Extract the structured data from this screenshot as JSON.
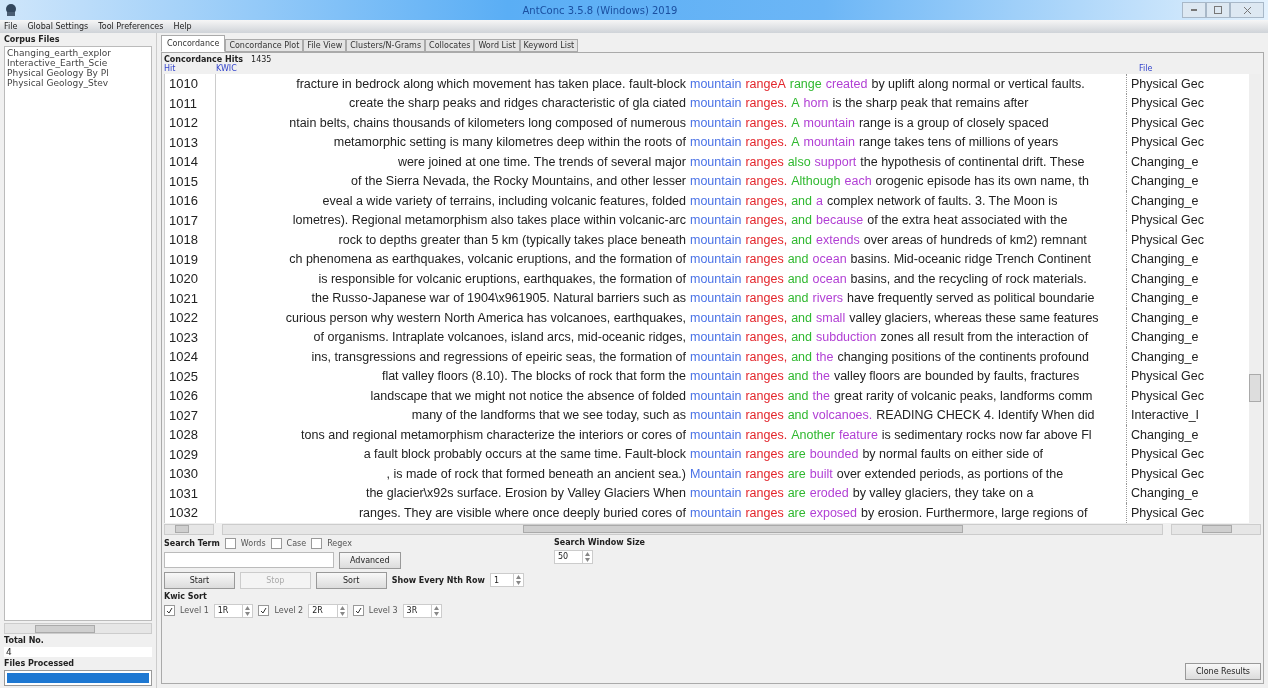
{
  "window": {
    "title": "AntConc 3.5.8 (Windows) 2019"
  },
  "menu": [
    "File",
    "Global Settings",
    "Tool Preferences",
    "Help"
  ],
  "sidebar": {
    "title": "Corpus Files",
    "files": [
      "Changing_earth_explor",
      "Interactive_Earth_Scie",
      "Physical Geology By Pl",
      "Physical Geology_Stev"
    ],
    "total_label": "Total No.",
    "total": "4",
    "processed_label": "Files Processed",
    "progress": {
      "level": 1
    }
  },
  "tabs": [
    {
      "label": "Concordance",
      "selected": true
    },
    {
      "label": "Concordance Plot",
      "selected": false
    },
    {
      "label": "File View",
      "selected": false
    },
    {
      "label": "Clusters/N-Grams",
      "selected": false
    },
    {
      "label": "Collocates",
      "selected": false
    },
    {
      "label": "Word List",
      "selected": false
    },
    {
      "label": "Keyword List",
      "selected": false
    }
  ],
  "hits_label": "Concordance Hits",
  "hits": "1435",
  "columns": [
    "Hit",
    "KWIC",
    "File"
  ],
  "rows": [
    {
      "hit": "1010",
      "left": "fracture in bedrock along which movement has taken place. fault-block",
      "keyword": "mountain",
      "r1": "rangeA",
      "r2": "range",
      "r3": "created",
      "rest": "by uplift along normal or vertical faults.",
      "file": "Physical Gec"
    },
    {
      "hit": "1011",
      "left": "create the sharp peaks and ridges characteristic of gla ciated",
      "keyword": "mountain",
      "r1": "ranges.",
      "r2": "A",
      "r3": "horn",
      "rest": "is the sharp peak that remains after",
      "file": "Physical Gec"
    },
    {
      "hit": "1012",
      "left": "ntain belts, chains thousands of kilometers long composed of numerous",
      "keyword": "mountain",
      "r1": "ranges.",
      "r2": "A",
      "r3": "mountain",
      "rest": "range is a group of closely spaced",
      "file": "Physical Gec"
    },
    {
      "hit": "1013",
      "left": "metamorphic setting is many kilometres deep within the roots of",
      "keyword": "mountain",
      "r1": "ranges.",
      "r2": "A",
      "r3": "mountain",
      "rest": "range takes tens of millions of years",
      "file": "Physical Gec"
    },
    {
      "hit": "1014",
      "left": "were joined at one time. The trends of several major",
      "keyword": "mountain",
      "r1": "ranges",
      "r2": "also",
      "r3": "support",
      "rest": "the hypothesis of continental drift. These",
      "file": "Changing_e"
    },
    {
      "hit": "1015",
      "left": "of the Sierra Nevada, the Rocky Mountains, and other lesser",
      "keyword": "mountain",
      "r1": "ranges.",
      "r2": "Although",
      "r3": "each",
      "rest": "orogenic episode has its own name, th",
      "file": "Changing_e"
    },
    {
      "hit": "1016",
      "left": "eveal a wide variety of terrains, including volcanic features, folded",
      "keyword": "mountain",
      "r1": "ranges,",
      "r2": "and",
      "r3": "a",
      "rest": "complex network of faults. 3. The Moon is",
      "file": "Changing_e"
    },
    {
      "hit": "1017",
      "left": "lometres). Regional metamorphism also takes place within volcanic-arc",
      "keyword": "mountain",
      "r1": "ranges,",
      "r2": "and",
      "r3": "because",
      "rest": "of the extra heat associated with the",
      "file": "Physical Gec"
    },
    {
      "hit": "1018",
      "left": "rock to depths greater than 5 km (typically takes place beneath",
      "keyword": "mountain",
      "r1": "ranges,",
      "r2": "and",
      "r3": "extends",
      "rest": "over areas of hundreds of km2) remnant",
      "file": "Physical Gec"
    },
    {
      "hit": "1019",
      "left": "ch phenomena as earthquakes, volcanic eruptions, and the formation of",
      "keyword": "mountain",
      "r1": "ranges",
      "r2": "and",
      "r3": "ocean",
      "rest": "basins. Mid-oceanic ridge Trench Continent",
      "file": "Changing_e"
    },
    {
      "hit": "1020",
      "left": "is responsible for volcanic eruptions, earthquakes, the formation of",
      "keyword": "mountain",
      "r1": "ranges",
      "r2": "and",
      "r3": "ocean",
      "rest": "basins, and the recycling of rock materials.",
      "file": "Changing_e"
    },
    {
      "hit": "1021",
      "left": "the Russo-Japanese war of 1904\\x961905. Natural barriers such as",
      "keyword": "mountain",
      "r1": "ranges",
      "r2": "and",
      "r3": "rivers",
      "rest": "have frequently served as political boundarie",
      "file": "Changing_e"
    },
    {
      "hit": "1022",
      "left": "curious person why western North America has volcanoes, earthquakes,",
      "keyword": "mountain",
      "r1": "ranges,",
      "r2": "and",
      "r3": "small",
      "rest": "valley glaciers, whereas these same features",
      "file": "Changing_e"
    },
    {
      "hit": "1023",
      "left": "of organisms. Intraplate volcanoes, island arcs, mid-oceanic ridges,",
      "keyword": "mountain",
      "r1": "ranges,",
      "r2": "and",
      "r3": "subduction",
      "rest": "zones all result from the interaction of",
      "file": "Changing_e"
    },
    {
      "hit": "1024",
      "left": "ins, transgressions and regressions of epeiric seas, the formation of",
      "keyword": "mountain",
      "r1": "ranges,",
      "r2": "and",
      "r3": "the",
      "rest": "changing positions of the continents profound",
      "file": "Changing_e"
    },
    {
      "hit": "1025",
      "left": "flat valley floors (8.10). The blocks of rock that form the",
      "keyword": "mountain",
      "r1": "ranges",
      "r2": "and",
      "r3": "the",
      "rest": "valley floors are bounded by faults, fractures",
      "file": "Physical Gec"
    },
    {
      "hit": "1026",
      "left": "landscape that we might not notice the absence of folded",
      "keyword": "mountain",
      "r1": "ranges",
      "r2": "and",
      "r3": "the",
      "rest": "great rarity of volcanic peaks, landforms comm",
      "file": "Physical Gec"
    },
    {
      "hit": "1027",
      "left": "many of the landforms that we see today, such as",
      "keyword": "mountain",
      "r1": "ranges",
      "r2": "and",
      "r3": "volcanoes.",
      "rest": "READING CHECK 4. Identify When did",
      "file": "Interactive_I"
    },
    {
      "hit": "1028",
      "left": "tons and regional metamorphism characterize the interiors or cores of",
      "keyword": "mountain",
      "r1": "ranges.",
      "r2": "Another",
      "r3": "feature",
      "rest": "is sedimentary rocks now far above Fl",
      "file": "Changing_e"
    },
    {
      "hit": "1029",
      "left": "a fault block probably occurs at the same time. Fault-block",
      "keyword": "mountain",
      "r1": "ranges",
      "r2": "are",
      "r3": "bounded",
      "rest": "by normal faults on either side of",
      "file": "Physical Gec"
    },
    {
      "hit": "1030",
      "left": ", is made of rock that formed beneath an ancient sea.)",
      "keyword": "Mountain",
      "r1": "ranges",
      "r2": "are",
      "r3": "built",
      "rest": "over extended periods, as portions of the",
      "file": "Physical Gec"
    },
    {
      "hit": "1031",
      "left": "the glacier\\x92s surface. Erosion by Valley Glaciers When",
      "keyword": "mountain",
      "r1": "ranges",
      "r2": "are",
      "r3": "eroded",
      "rest": "by valley glaciers, they take on a",
      "file": "Changing_e"
    },
    {
      "hit": "1032",
      "left": "ranges. They are visible where once deeply buried cores of",
      "keyword": "mountain",
      "r1": "ranges",
      "r2": "are",
      "r3": "exposed",
      "rest": "by erosion. Furthermore, large regions of",
      "file": "Physical Gec"
    }
  ],
  "search": {
    "label": "Search Term",
    "options": [
      {
        "label": "Words",
        "checked": false
      },
      {
        "label": "Case",
        "checked": false
      },
      {
        "label": "Regex",
        "checked": false
      }
    ],
    "advanced": "Advanced",
    "window_label": "Search Window Size",
    "window_value": "50"
  },
  "buttons": [
    {
      "label": "Start",
      "disabled": false
    },
    {
      "label": "Stop",
      "disabled": true
    },
    {
      "label": "Sort",
      "disabled": false
    }
  ],
  "nth": {
    "label": "Show Every Nth Row",
    "value": "1"
  },
  "kwic_sort": {
    "label": "Kwic Sort",
    "levels": [
      {
        "label": "Level 1",
        "checked": true,
        "value": "1R"
      },
      {
        "label": "Level 2",
        "checked": true,
        "value": "2R"
      },
      {
        "label": "Level 3",
        "checked": true,
        "value": "3R"
      }
    ]
  },
  "clone": "Clone Results"
}
